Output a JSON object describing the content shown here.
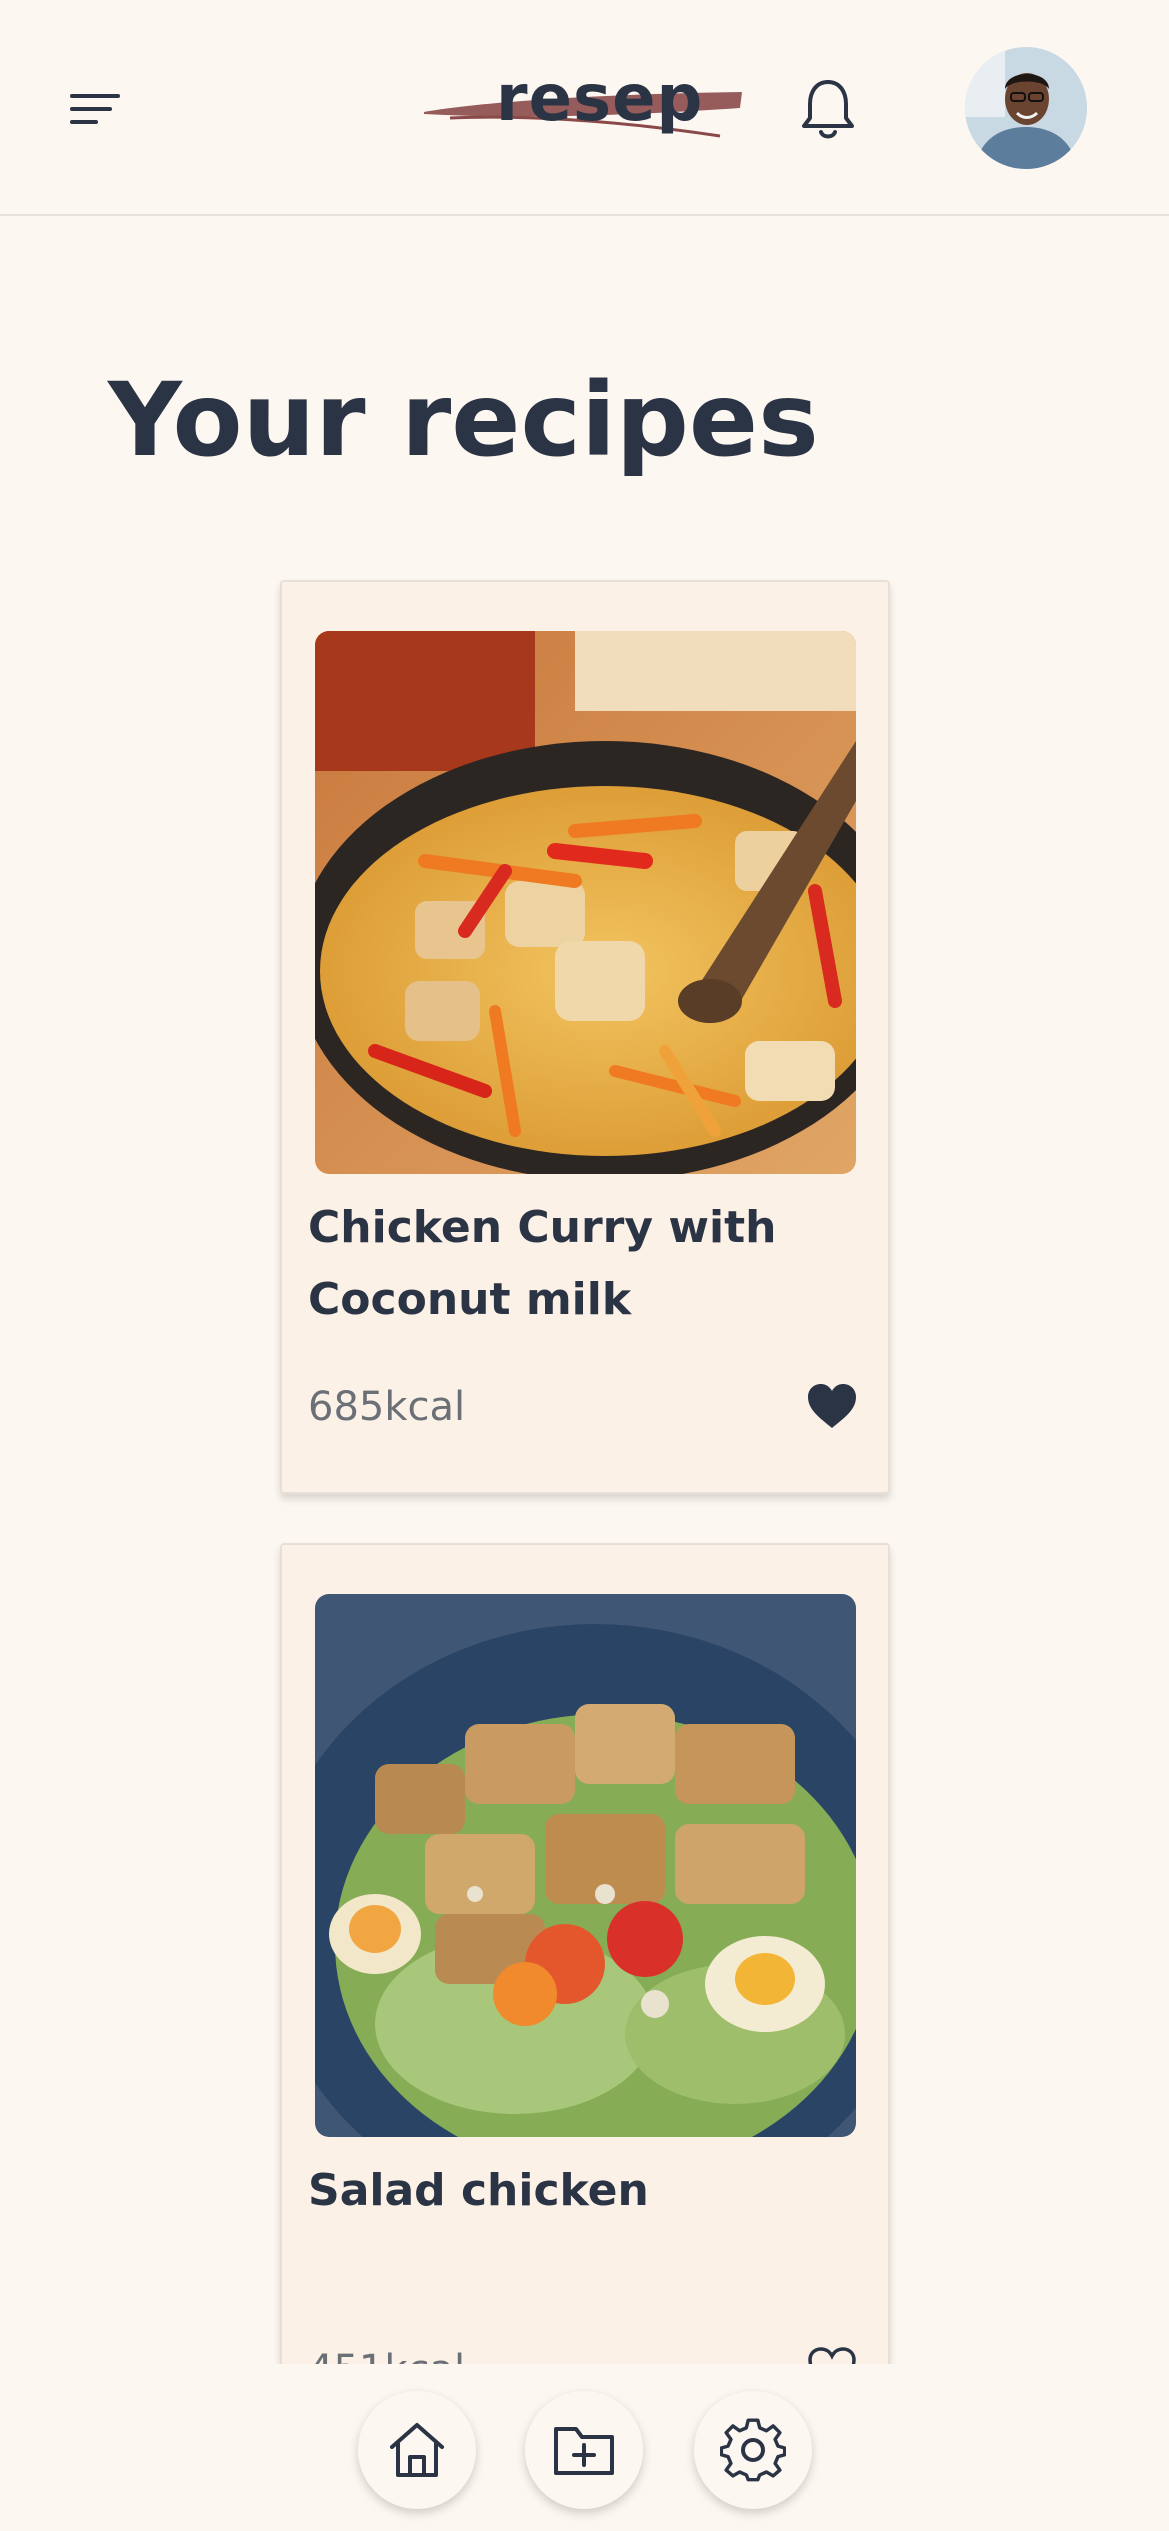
{
  "app": {
    "logo_text": "resep",
    "icons": {
      "menu": "menu-icon",
      "notifications": "bell-icon",
      "avatar": "user-avatar"
    }
  },
  "main": {
    "title": "Your recipes",
    "recipes": [
      {
        "title": "Chicken Curry with Coconut milk",
        "kcal": "685kcal",
        "favorite": true,
        "image": "chicken curry in pan photo"
      },
      {
        "title": "Salad chicken",
        "kcal": "451kcal",
        "favorite": false,
        "image": "chicken salad bowl photo"
      }
    ]
  },
  "bottom_nav": {
    "items": [
      {
        "icon": "home-icon"
      },
      {
        "icon": "folder-plus-icon"
      },
      {
        "icon": "gear-icon"
      }
    ]
  },
  "colors": {
    "background": "#fdf7f2",
    "card": "#fcf1e7",
    "text": "#2b3445",
    "muted": "#6b7077",
    "logo_swash": "#8b4a4a"
  }
}
